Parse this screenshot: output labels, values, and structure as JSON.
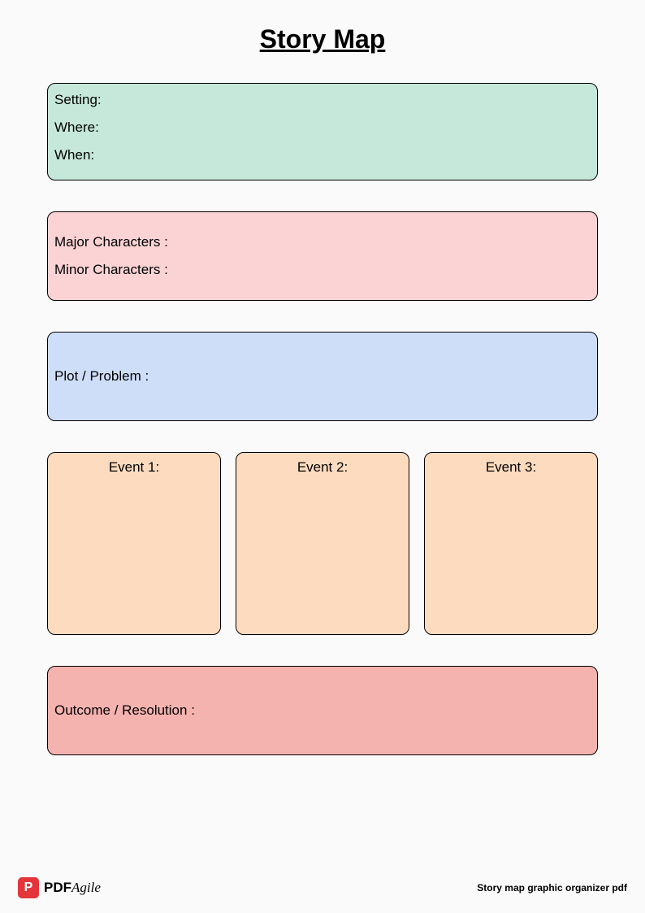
{
  "title": "Story Map",
  "setting": {
    "setting_label": "Setting:",
    "where_label": "Where:",
    "when_label": "When:"
  },
  "characters": {
    "major_label": "Major Characters :",
    "minor_label": "Minor Characters :"
  },
  "plot": {
    "label": "Plot / Problem :"
  },
  "events": {
    "event1_label": "Event 1:",
    "event2_label": "Event 2:",
    "event3_label": "Event 3:"
  },
  "outcome": {
    "label": "Outcome / Resolution :"
  },
  "footer": {
    "logo_pdf": "PDF",
    "logo_agile": "Agile",
    "caption": "Story map graphic organizer pdf"
  }
}
